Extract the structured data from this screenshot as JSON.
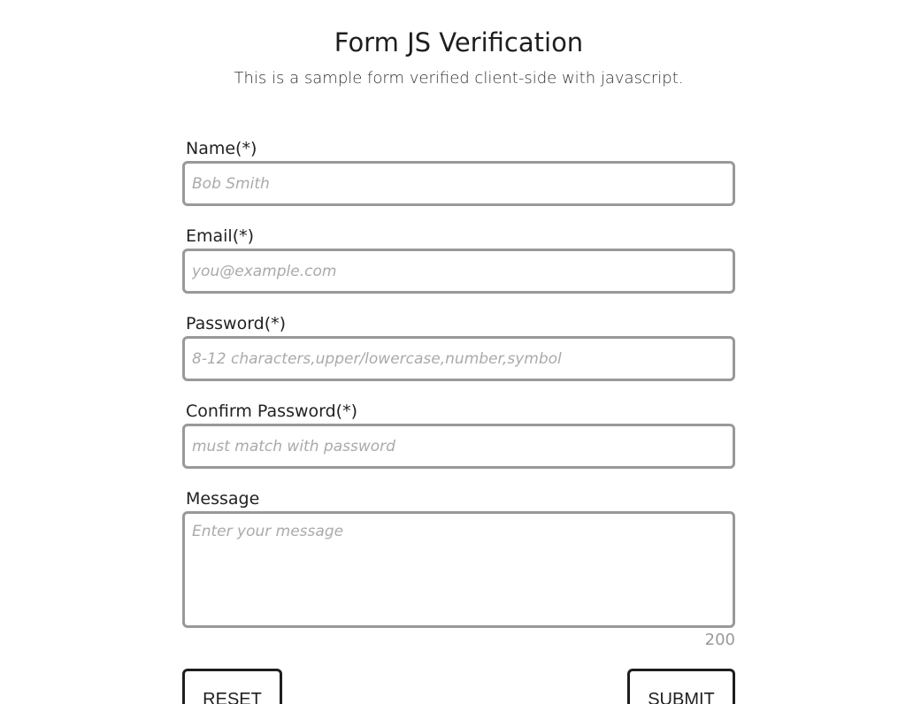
{
  "header": {
    "title": "Form JS Verification",
    "subtitle": "This is a sample form verified client-side with javascript."
  },
  "form": {
    "name": {
      "label": "Name(*)",
      "placeholder": "Bob Smith",
      "value": ""
    },
    "email": {
      "label": "Email(*)",
      "placeholder": "you@example.com",
      "value": ""
    },
    "password": {
      "label": "Password(*)",
      "placeholder": "8-12 characters,upper/lowercase,number,symbol",
      "value": ""
    },
    "confirm_password": {
      "label": "Confirm Password(*)",
      "placeholder": "must match with password",
      "value": ""
    },
    "message": {
      "label": "Message",
      "placeholder": "Enter your message",
      "value": "",
      "char_count": "200"
    }
  },
  "buttons": {
    "reset_label": "RESET",
    "submit_label": "SUBMIT"
  }
}
